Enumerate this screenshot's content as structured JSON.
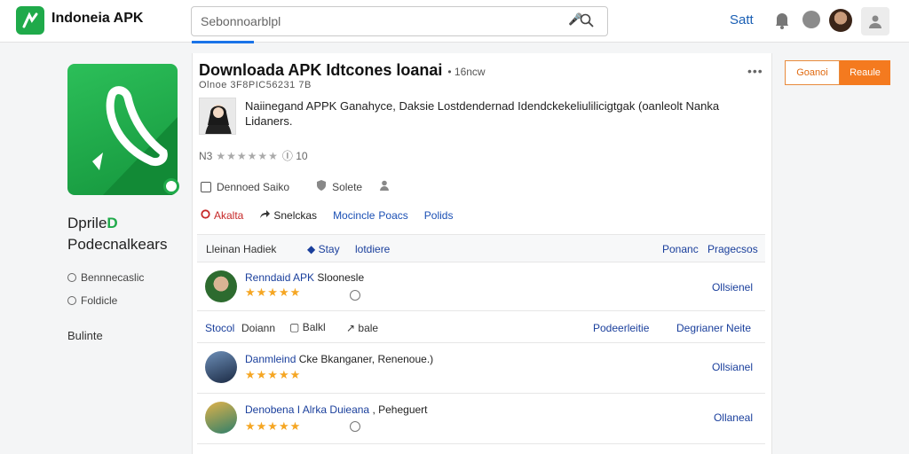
{
  "header": {
    "brand": "Indoneia APK",
    "search_placeholder": "Sebonnoarblpl",
    "link": "Satt",
    "icons": [
      "logo-icon",
      "mic-icon",
      "search-icon",
      "bell-icon",
      "notification-icon",
      "user-avatar",
      "account-icon"
    ]
  },
  "sidebar": {
    "title_line1": "Dprile",
    "title_badge": "D",
    "title_line2": "Podecnalkears",
    "items": [
      {
        "label": "Bennnecaslic"
      },
      {
        "label": "Foldicle"
      }
    ],
    "extra": "Bulinte"
  },
  "app": {
    "title": "Downloada APK Idtcones loanai",
    "title_suffix": "• 16ncw",
    "meta": "Olnoe 3F8PIC56231 7B",
    "description": "Naiinegand APPK Ganahyce, Daksie Lostdendernad Idendckekeliulilicigtgak (oanleolt Nanka Lidaners.",
    "rating_prefix": "N3",
    "rating_suffix": "Ⓘ 10",
    "stars": "★★★★★★",
    "meta_row": {
      "item1": "Dennoed Saiko",
      "item2": "Solete"
    }
  },
  "tabs": [
    {
      "label": "Akalta",
      "type": "active"
    },
    {
      "label": "Snelckas",
      "type": "normal"
    },
    {
      "label": "Mocincle",
      "type": "blue"
    },
    {
      "label": "Poacs",
      "type": "blue"
    },
    {
      "label": "Polids",
      "type": "blue"
    }
  ],
  "list_header": {
    "col1": "Lleinan Hadiek",
    "col2": "Stay",
    "col3": "lotdiere",
    "col4": "Ponanc",
    "col5": "Pragecsos"
  },
  "row1": {
    "title_blue": "Renndaid APK",
    "title_dark": "Sloonesle",
    "stars": "★★★★★",
    "link": "Ollsienel"
  },
  "bar2": {
    "item1": "Stocol",
    "item2": "Doiann",
    "item3": "Balkl",
    "item4": "bale",
    "item5": "Podeerleitie",
    "item6": "Degrianer Neite"
  },
  "row2": {
    "title_blue": "Danmleind",
    "title_dark": "Cke Bkanganer, Renenoue.)",
    "stars": "★★★★★",
    "link": "Ollsianel"
  },
  "row3": {
    "title_blue": "Denobena I Alrka Duieana",
    "title_dark": ", Peheguert",
    "stars": "★★★★★",
    "link": "Ollaneal"
  },
  "buttons": {
    "outline": "Goanoi",
    "filled": "Reaule"
  },
  "colors": {
    "brand_green": "#1faa4a",
    "accent_orange": "#f47a1f",
    "link_blue": "#1a3f9c",
    "star_gold": "#f5a623"
  }
}
